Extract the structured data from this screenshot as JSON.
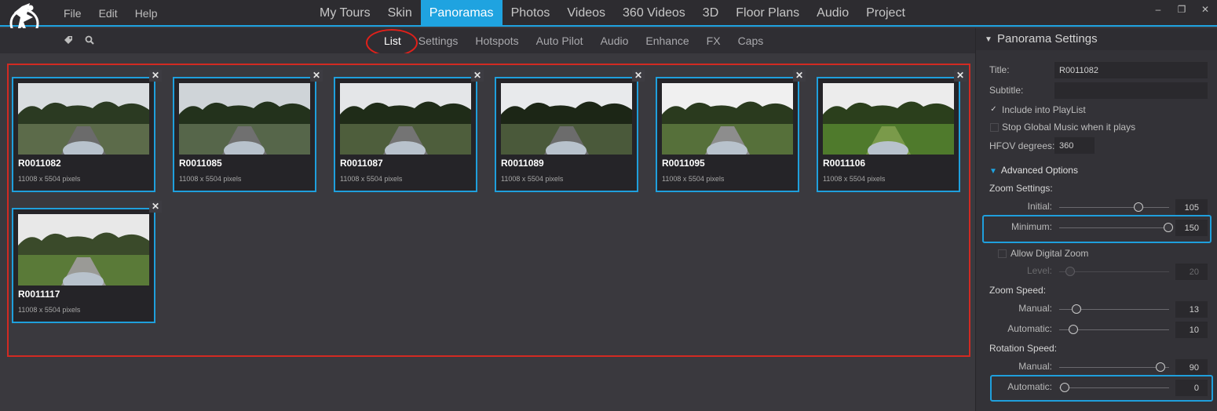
{
  "menu": [
    "File",
    "Edit",
    "Help"
  ],
  "main_tabs": [
    "My Tours",
    "Skin",
    "Panoramas",
    "Photos",
    "Videos",
    "360 Videos",
    "3D",
    "Floor Plans",
    "Audio",
    "Project"
  ],
  "active_main_tab": "Panoramas",
  "window_controls": [
    "–",
    "❐",
    "✕"
  ],
  "sub_tabs": [
    "List",
    "Settings",
    "Hotspots",
    "Auto Pilot",
    "Audio",
    "Enhance",
    "FX",
    "Caps"
  ],
  "active_sub_tab": "List",
  "toolbar_icons": [
    "tag-icon",
    "search-icon"
  ],
  "panoramas": [
    {
      "title": "R0011082",
      "size": "11008 x 5504 pixels"
    },
    {
      "title": "R0011085",
      "size": "11008 x 5504 pixels"
    },
    {
      "title": "R0011087",
      "size": "11008 x 5504 pixels"
    },
    {
      "title": "R0011089",
      "size": "11008 x 5504 pixels"
    },
    {
      "title": "R0011095",
      "size": "11008 x 5504 pixels"
    },
    {
      "title": "R0011106",
      "size": "11008 x 5504 pixels"
    },
    {
      "title": "R0011117",
      "size": "11008 x 5504 pixels"
    }
  ],
  "panel": {
    "header": "Panorama Settings",
    "title_label": "Title:",
    "title_value": "R0011082",
    "subtitle_label": "Subtitle:",
    "subtitle_value": "",
    "include_playlist": "Include into PlayList",
    "include_playlist_checked": true,
    "stop_music": "Stop Global Music when it plays",
    "stop_music_checked": false,
    "hfov_label": "HFOV degrees:",
    "hfov_value": "360",
    "advanced": "Advanced Options",
    "zoom_settings": "Zoom Settings:",
    "initial_label": "Initial:",
    "initial_value": "105",
    "minimum_label": "Minimum:",
    "minimum_value": "150",
    "allow_digital_zoom": "Allow Digital Zoom",
    "allow_digital_zoom_checked": false,
    "level_label": "Level:",
    "level_value": "20",
    "zoom_speed": "Zoom Speed:",
    "zs_manual_label": "Manual:",
    "zs_manual_value": "13",
    "zs_auto_label": "Automatic:",
    "zs_auto_value": "10",
    "rotation_speed": "Rotation Speed:",
    "rs_manual_label": "Manual:",
    "rs_manual_value": "90",
    "rs_auto_label": "Automatic:",
    "rs_auto_value": "0"
  },
  "slider_levels": {
    "initial": 0.72,
    "minimum": 0.99,
    "level": 0.1,
    "zs_manual": 0.16,
    "zs_auto": 0.13,
    "rs_manual": 0.92,
    "rs_auto": 0.05
  },
  "colors": {
    "accent": "#1fa3e0",
    "annotation_red": "#e0201a",
    "background": "#3a393e"
  }
}
